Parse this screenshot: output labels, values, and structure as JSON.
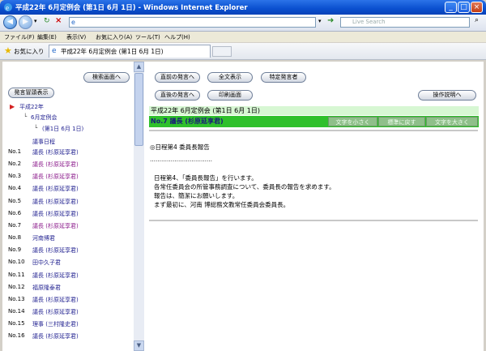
{
  "window": {
    "title": "平成22年 6月定例会 (第1日 6月 1日) - Windows Internet Explorer",
    "minimize": "_",
    "maximize": "□",
    "close": "×"
  },
  "browser": {
    "search_placeholder": "Live Search",
    "menu": [
      "ファイル(F)",
      "編集(E)",
      "表示(V)",
      "お気に入り(A)",
      "ツール(T)",
      "ヘルプ(H)"
    ],
    "favorites_label": "お気に入り",
    "tab_title": "平成22年 6月定例会 (第1日 6月 1日)"
  },
  "left_pane": {
    "search_button": "検索画面へ",
    "speaker_list_button": "発言冒頭表示",
    "tree": {
      "year": "平成22年",
      "session": "6月定例会",
      "day": "(第1日 6月 1日)"
    },
    "agenda": "議事日程",
    "items": [
      {
        "no": "No.1",
        "name": "議長 (杉原延享君)",
        "style": "link"
      },
      {
        "no": "No.2",
        "name": "議長 (杉原延享君)",
        "style": "mag"
      },
      {
        "no": "No.3",
        "name": "議長 (杉原延享君)",
        "style": "mag"
      },
      {
        "no": "No.4",
        "name": "議長 (杉原延享君)",
        "style": "link"
      },
      {
        "no": "No.5",
        "name": "議長 (杉原延享君)",
        "style": "link"
      },
      {
        "no": "No.6",
        "name": "議長 (杉原延享君)",
        "style": "link"
      },
      {
        "no": "No.7",
        "name": "議長 (杉原延享君)",
        "style": "mag"
      },
      {
        "no": "No.8",
        "name": "河南博君",
        "style": "link"
      },
      {
        "no": "No.9",
        "name": "議長 (杉原延享君)",
        "style": "link"
      },
      {
        "no": "No.10",
        "name": "田中久子君",
        "style": "link"
      },
      {
        "no": "No.11",
        "name": "議長 (杉原延享君)",
        "style": "link"
      },
      {
        "no": "No.12",
        "name": "福原隆泰君",
        "style": "link"
      },
      {
        "no": "No.13",
        "name": "議長 (杉原延享君)",
        "style": "link"
      },
      {
        "no": "No.14",
        "name": "議長 (杉原延享君)",
        "style": "link"
      },
      {
        "no": "No.15",
        "name": "理事 (三村隆史君)",
        "style": "link"
      },
      {
        "no": "No.16",
        "name": "議長 (杉原延享君)",
        "style": "link"
      }
    ]
  },
  "toolbar": {
    "prev_speaker": "直前の発言へ",
    "show_all": "全文表示",
    "specific_speaker": "特定発言者",
    "next_speaker": "直後の発言へ",
    "print": "印刷画面",
    "help": "操作説明へ"
  },
  "document": {
    "session_header": "平成22年 6月定例会 (第1日 6月 1日)",
    "speaker": "No.7 議長 (杉原延享君)",
    "font_smaller": "文字を小さく",
    "font_reset": "標準に戻す",
    "font_larger": "文字を大きく",
    "agenda_item": "◎日程第4 委員長報告",
    "dots": "……………………………",
    "body": [
      "日程第4、「委員長報告」を行います。",
      "各常任委員会の所管事務調査について、委員長の報告を求めます。",
      "報告は、簡潔にお願いします。",
      "まず最初に、河南 博総務文教常任委員会委員長。"
    ]
  },
  "colors": {
    "header_green_light": "#d7f7d3",
    "speaker_green": "#2fc02b",
    "link_blue": "#1f1f8f",
    "link_magenta": "#8b1a8b"
  }
}
